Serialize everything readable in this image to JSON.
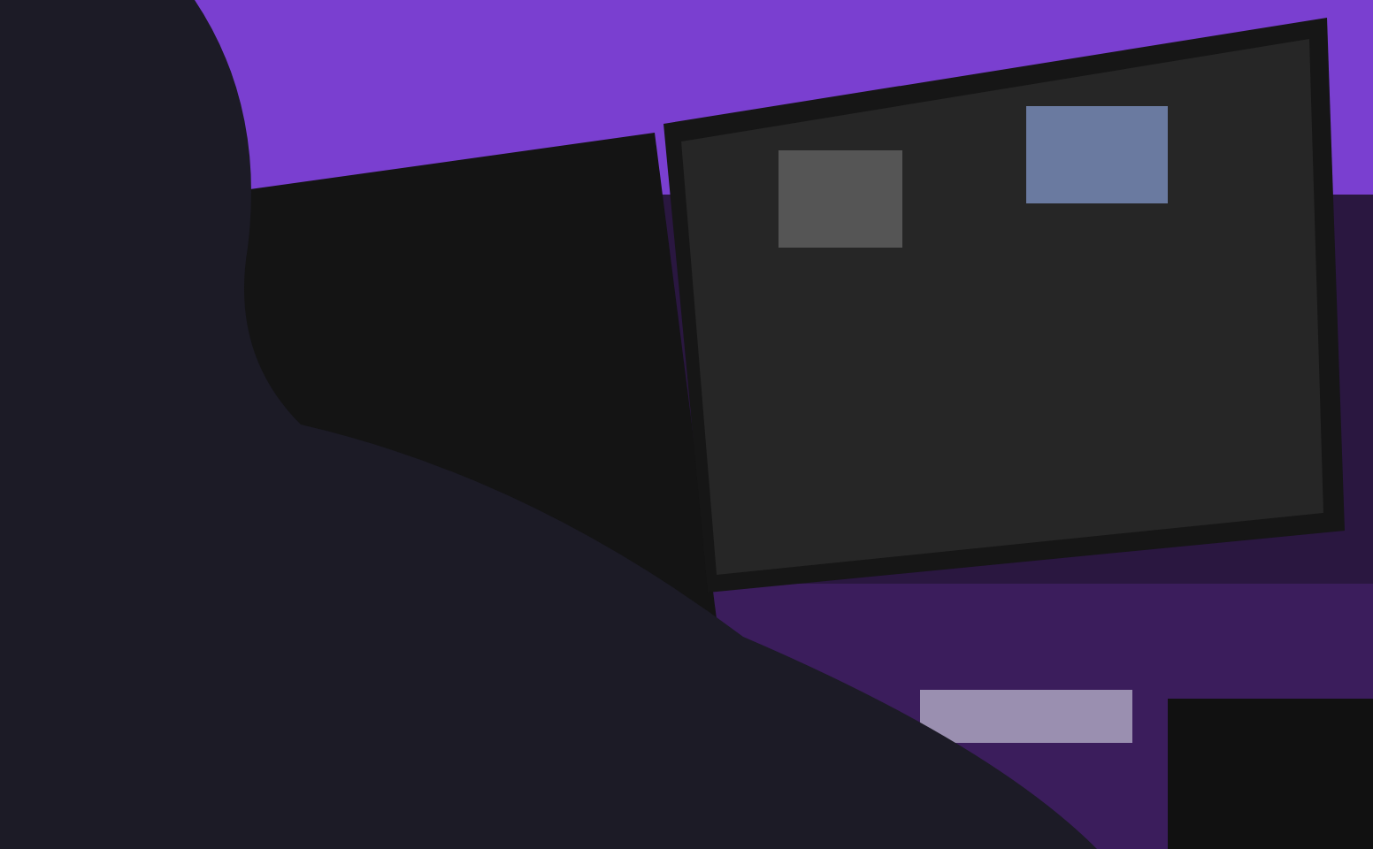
{
  "photo": {
    "kind": "photo"
  }
}
